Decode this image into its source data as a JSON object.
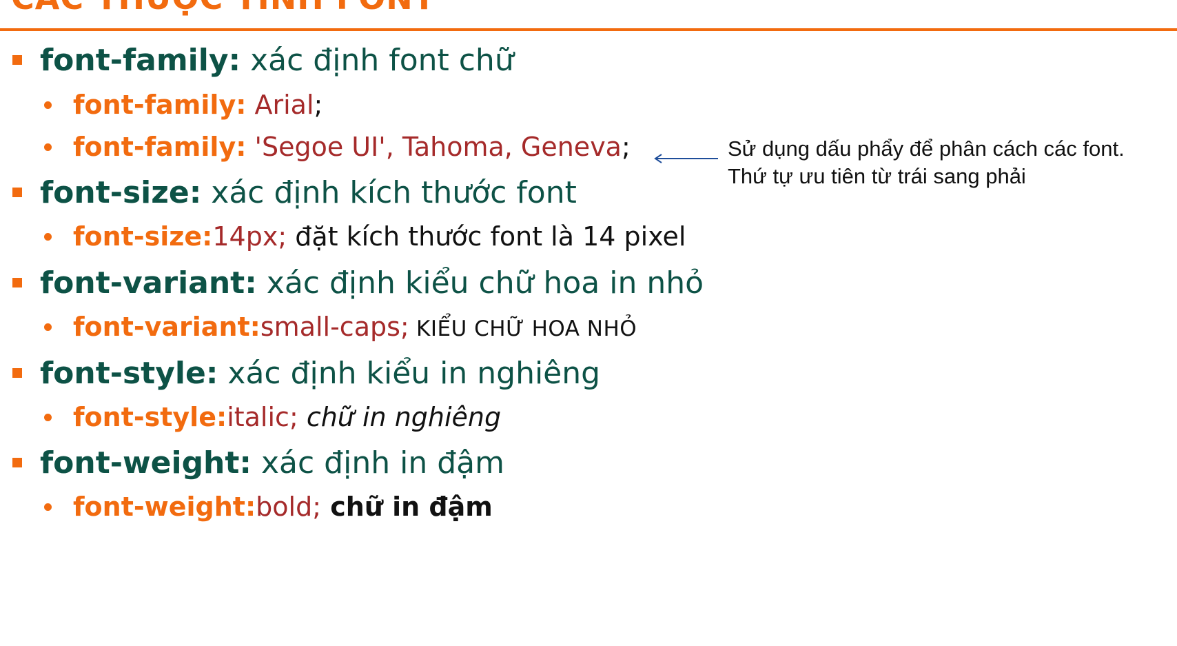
{
  "slide": {
    "title": "CÁC THUỘC TÍNH FONT"
  },
  "items": [
    {
      "prop": "font-family:",
      "desc": " xác định font chữ",
      "examples": [
        {
          "prop": "font-family:",
          "value": " Arial",
          "punct": ";",
          "sample": ""
        },
        {
          "prop": "font-family:",
          "value": " 'Segoe UI', Tahoma, Geneva",
          "punct": ";",
          "sample": ""
        }
      ]
    },
    {
      "prop": "font-size:",
      "desc": " xác định kích thước font",
      "examples": [
        {
          "prop": "font-size:",
          "value": "14px;",
          "punct": "",
          "sample": " đặt kích thước font là 14 pixel"
        }
      ]
    },
    {
      "prop": "font-variant:",
      "desc": " xác định kiểu chữ hoa in nhỏ",
      "examples": [
        {
          "prop": "font-variant:",
          "value": "small-caps;",
          "punct": "",
          "sample": " KIỂU CHỮ HOA NHỎ"
        }
      ]
    },
    {
      "prop": "font-style:",
      "desc": " xác định kiểu in nghiêng",
      "examples": [
        {
          "prop": "font-style:",
          "value": "italic;",
          "punct": "",
          "sample": " chữ in nghiêng"
        }
      ]
    },
    {
      "prop": "font-weight:",
      "desc": " xác định in đậm",
      "examples": [
        {
          "prop": "font-weight:",
          "value": "bold;",
          "punct": "",
          "sample": " chữ in đậm"
        }
      ]
    }
  ],
  "note": {
    "line1": "Sử dụng dấu phẩy để phân cách các font.",
    "line2": "Thứ tự ưu tiên từ trái sang phải"
  },
  "colors": {
    "accent": "#f26b0f",
    "heading": "#0d5246",
    "value": "#a52a2a",
    "arrow": "#1f4e9a"
  }
}
